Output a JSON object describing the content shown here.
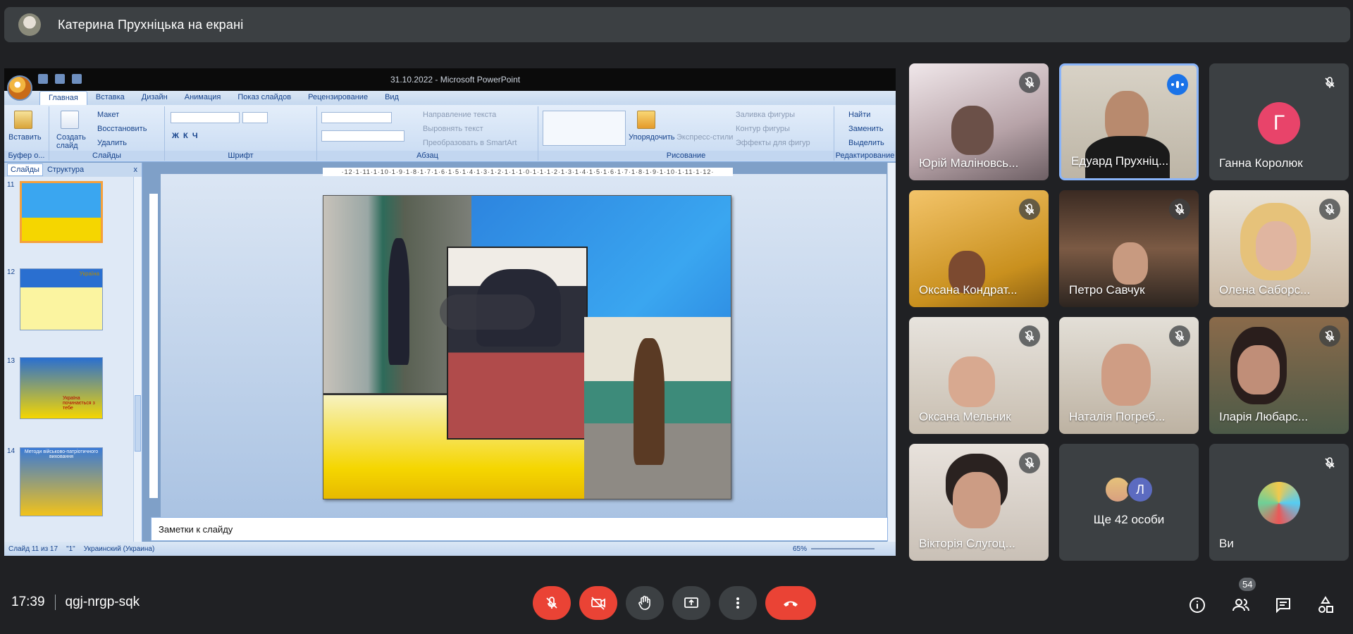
{
  "presenter": {
    "banner": "Катерина Прухніцька на екрані"
  },
  "powerpoint": {
    "title": "31.10.2022 - Microsoft PowerPoint",
    "tabs": [
      "Главная",
      "Вставка",
      "Дизайн",
      "Анимация",
      "Показ слайдов",
      "Рецензирование",
      "Вид"
    ],
    "groups": {
      "clipboard": {
        "label": "Буфер о...",
        "paste": "Вставить"
      },
      "slides": {
        "label": "Слайды",
        "create": "Создать слайд",
        "layout": "Макет",
        "reset": "Восстановить",
        "delete": "Удалить"
      },
      "font": {
        "label": "Шрифт"
      },
      "paragraph": {
        "label": "Абзац",
        "text_dir": "Направление текста",
        "align_text": "Выровнять текст",
        "smartart": "Преобразовать в SmartArt"
      },
      "drawing": {
        "label": "Рисование",
        "arrange": "Упорядочить",
        "quick_styles": "Экспресс-стили",
        "fill": "Заливка фигуры",
        "outline": "Контур фигуры",
        "effects": "Эффекты для фигур"
      },
      "editing": {
        "label": "Редактирование",
        "find": "Найти",
        "replace": "Заменить",
        "select": "Выделить"
      }
    },
    "left_pane": {
      "tab_slides": "Слайды",
      "tab_outline": "Структура",
      "close": "x",
      "thumbnails": [
        {
          "num": "11"
        },
        {
          "num": "12",
          "tag": "Україна"
        },
        {
          "num": "13",
          "tag": "Україна починається з тебе"
        },
        {
          "num": "14",
          "tag": "Методи військово-патріотичного виховання"
        }
      ]
    },
    "ruler": "·12·1·11·1·10·1·9·1·8·1·7·1·6·1·5·1·4·1·3·1·2·1·1·1·0·1·1·1·2·1·3·1·4·1·5·1·6·1·7·1·8·1·9·1·10·1·11·1·12·",
    "notes_placeholder": "Заметки к слайду",
    "status": {
      "slide": "Слайд 11 из 17",
      "theme": "\"1\"",
      "language": "Украинский (Украина)",
      "zoom": "65%"
    }
  },
  "participants": [
    {
      "name": "Юрій Маліновсь...",
      "muted": true
    },
    {
      "name": "Едуард Прухніц...",
      "speaking": true
    },
    {
      "name": "Ганна Королюк",
      "muted": true,
      "initial": "Г"
    },
    {
      "name": "Оксана Кондрат...",
      "muted": true
    },
    {
      "name": "Петро Савчук",
      "muted": true
    },
    {
      "name": "Олена Саборс...",
      "muted": true
    },
    {
      "name": "Оксана Мельник",
      "muted": true
    },
    {
      "name": "Наталія Погреб...",
      "muted": true
    },
    {
      "name": "Іларія Любарс...",
      "muted": true
    },
    {
      "name": "Вікторія Слугоц...",
      "muted": true
    },
    {
      "name": "Ще 42 особи",
      "extra_initial": "Л"
    },
    {
      "name": "Ви",
      "muted": true
    }
  ],
  "meeting": {
    "time": "17:39",
    "code": "qgj-nrgp-sqk",
    "people_count": "54"
  },
  "colors": {
    "accent": "#8ab4f8",
    "end_call": "#ea4335",
    "bg": "#202124"
  }
}
